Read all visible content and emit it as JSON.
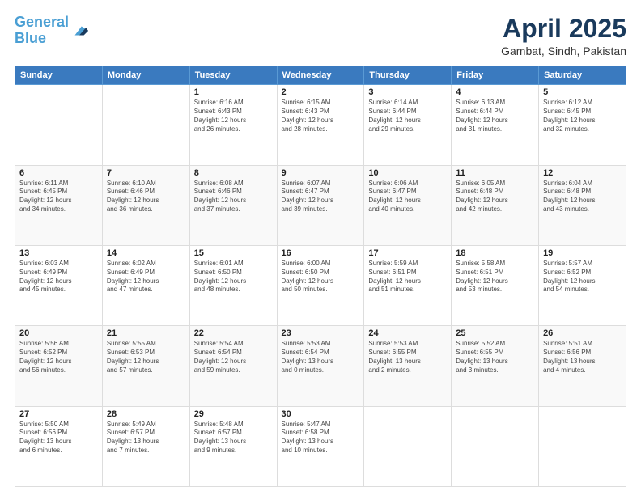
{
  "header": {
    "logo_line1": "General",
    "logo_line2": "Blue",
    "main_title": "April 2025",
    "sub_title": "Gambat, Sindh, Pakistan"
  },
  "days_of_week": [
    "Sunday",
    "Monday",
    "Tuesday",
    "Wednesday",
    "Thursday",
    "Friday",
    "Saturday"
  ],
  "weeks": [
    [
      {
        "day": "",
        "lines": []
      },
      {
        "day": "",
        "lines": []
      },
      {
        "day": "1",
        "lines": [
          "Sunrise: 6:16 AM",
          "Sunset: 6:43 PM",
          "Daylight: 12 hours",
          "and 26 minutes."
        ]
      },
      {
        "day": "2",
        "lines": [
          "Sunrise: 6:15 AM",
          "Sunset: 6:43 PM",
          "Daylight: 12 hours",
          "and 28 minutes."
        ]
      },
      {
        "day": "3",
        "lines": [
          "Sunrise: 6:14 AM",
          "Sunset: 6:44 PM",
          "Daylight: 12 hours",
          "and 29 minutes."
        ]
      },
      {
        "day": "4",
        "lines": [
          "Sunrise: 6:13 AM",
          "Sunset: 6:44 PM",
          "Daylight: 12 hours",
          "and 31 minutes."
        ]
      },
      {
        "day": "5",
        "lines": [
          "Sunrise: 6:12 AM",
          "Sunset: 6:45 PM",
          "Daylight: 12 hours",
          "and 32 minutes."
        ]
      }
    ],
    [
      {
        "day": "6",
        "lines": [
          "Sunrise: 6:11 AM",
          "Sunset: 6:45 PM",
          "Daylight: 12 hours",
          "and 34 minutes."
        ]
      },
      {
        "day": "7",
        "lines": [
          "Sunrise: 6:10 AM",
          "Sunset: 6:46 PM",
          "Daylight: 12 hours",
          "and 36 minutes."
        ]
      },
      {
        "day": "8",
        "lines": [
          "Sunrise: 6:08 AM",
          "Sunset: 6:46 PM",
          "Daylight: 12 hours",
          "and 37 minutes."
        ]
      },
      {
        "day": "9",
        "lines": [
          "Sunrise: 6:07 AM",
          "Sunset: 6:47 PM",
          "Daylight: 12 hours",
          "and 39 minutes."
        ]
      },
      {
        "day": "10",
        "lines": [
          "Sunrise: 6:06 AM",
          "Sunset: 6:47 PM",
          "Daylight: 12 hours",
          "and 40 minutes."
        ]
      },
      {
        "day": "11",
        "lines": [
          "Sunrise: 6:05 AM",
          "Sunset: 6:48 PM",
          "Daylight: 12 hours",
          "and 42 minutes."
        ]
      },
      {
        "day": "12",
        "lines": [
          "Sunrise: 6:04 AM",
          "Sunset: 6:48 PM",
          "Daylight: 12 hours",
          "and 43 minutes."
        ]
      }
    ],
    [
      {
        "day": "13",
        "lines": [
          "Sunrise: 6:03 AM",
          "Sunset: 6:49 PM",
          "Daylight: 12 hours",
          "and 45 minutes."
        ]
      },
      {
        "day": "14",
        "lines": [
          "Sunrise: 6:02 AM",
          "Sunset: 6:49 PM",
          "Daylight: 12 hours",
          "and 47 minutes."
        ]
      },
      {
        "day": "15",
        "lines": [
          "Sunrise: 6:01 AM",
          "Sunset: 6:50 PM",
          "Daylight: 12 hours",
          "and 48 minutes."
        ]
      },
      {
        "day": "16",
        "lines": [
          "Sunrise: 6:00 AM",
          "Sunset: 6:50 PM",
          "Daylight: 12 hours",
          "and 50 minutes."
        ]
      },
      {
        "day": "17",
        "lines": [
          "Sunrise: 5:59 AM",
          "Sunset: 6:51 PM",
          "Daylight: 12 hours",
          "and 51 minutes."
        ]
      },
      {
        "day": "18",
        "lines": [
          "Sunrise: 5:58 AM",
          "Sunset: 6:51 PM",
          "Daylight: 12 hours",
          "and 53 minutes."
        ]
      },
      {
        "day": "19",
        "lines": [
          "Sunrise: 5:57 AM",
          "Sunset: 6:52 PM",
          "Daylight: 12 hours",
          "and 54 minutes."
        ]
      }
    ],
    [
      {
        "day": "20",
        "lines": [
          "Sunrise: 5:56 AM",
          "Sunset: 6:52 PM",
          "Daylight: 12 hours",
          "and 56 minutes."
        ]
      },
      {
        "day": "21",
        "lines": [
          "Sunrise: 5:55 AM",
          "Sunset: 6:53 PM",
          "Daylight: 12 hours",
          "and 57 minutes."
        ]
      },
      {
        "day": "22",
        "lines": [
          "Sunrise: 5:54 AM",
          "Sunset: 6:54 PM",
          "Daylight: 12 hours",
          "and 59 minutes."
        ]
      },
      {
        "day": "23",
        "lines": [
          "Sunrise: 5:53 AM",
          "Sunset: 6:54 PM",
          "Daylight: 13 hours",
          "and 0 minutes."
        ]
      },
      {
        "day": "24",
        "lines": [
          "Sunrise: 5:53 AM",
          "Sunset: 6:55 PM",
          "Daylight: 13 hours",
          "and 2 minutes."
        ]
      },
      {
        "day": "25",
        "lines": [
          "Sunrise: 5:52 AM",
          "Sunset: 6:55 PM",
          "Daylight: 13 hours",
          "and 3 minutes."
        ]
      },
      {
        "day": "26",
        "lines": [
          "Sunrise: 5:51 AM",
          "Sunset: 6:56 PM",
          "Daylight: 13 hours",
          "and 4 minutes."
        ]
      }
    ],
    [
      {
        "day": "27",
        "lines": [
          "Sunrise: 5:50 AM",
          "Sunset: 6:56 PM",
          "Daylight: 13 hours",
          "and 6 minutes."
        ]
      },
      {
        "day": "28",
        "lines": [
          "Sunrise: 5:49 AM",
          "Sunset: 6:57 PM",
          "Daylight: 13 hours",
          "and 7 minutes."
        ]
      },
      {
        "day": "29",
        "lines": [
          "Sunrise: 5:48 AM",
          "Sunset: 6:57 PM",
          "Daylight: 13 hours",
          "and 9 minutes."
        ]
      },
      {
        "day": "30",
        "lines": [
          "Sunrise: 5:47 AM",
          "Sunset: 6:58 PM",
          "Daylight: 13 hours",
          "and 10 minutes."
        ]
      },
      {
        "day": "",
        "lines": []
      },
      {
        "day": "",
        "lines": []
      },
      {
        "day": "",
        "lines": []
      }
    ]
  ]
}
